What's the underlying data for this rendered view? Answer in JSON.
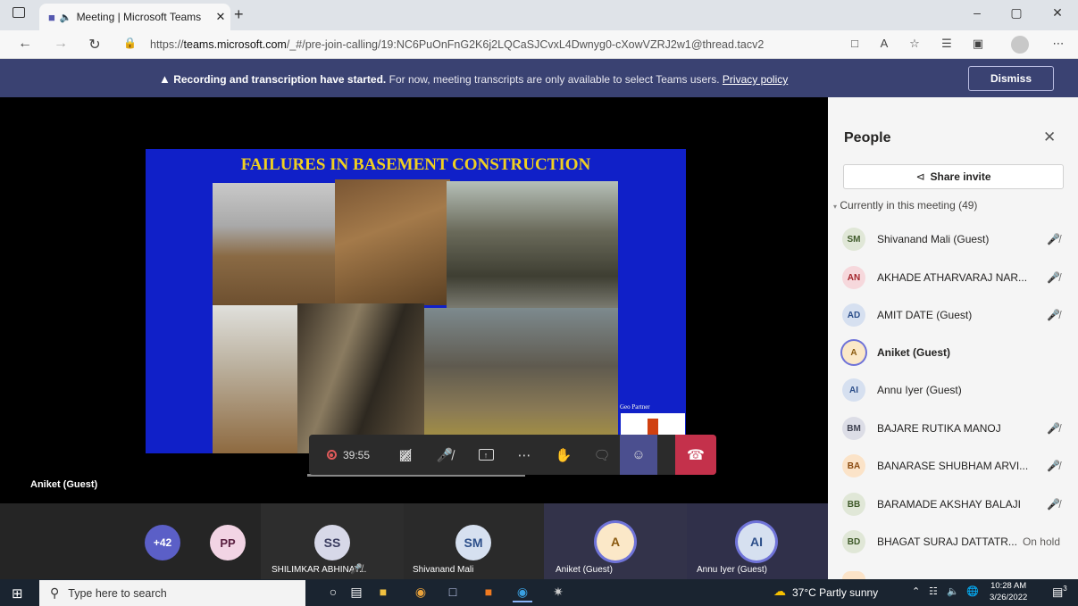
{
  "browser": {
    "tab_title": "Meeting | Microsoft Teams",
    "tab_audio_icon": "speaker-icon",
    "new_tab": "+",
    "url_prefix": "https://",
    "url_host": "teams.microsoft.com",
    "url_path": "/_#/pre-join-calling/19:NC6PuOnFnG2K6j2LQCaSJCvxL4Dwnyg0-cXowVZRJ2w1@thread.tacv2",
    "win_min": "–",
    "win_max": "▢",
    "win_close": "✕"
  },
  "banner": {
    "bold_text": "Recording and transcription have started.",
    "text": " For now, meeting transcripts are only available to select Teams users. ",
    "link": "Privacy policy",
    "dismiss": "Dismiss",
    "bg": "#3a4272"
  },
  "stage": {
    "slide_title": "FAILURES IN BASEMENT CONSTRUCTION",
    "slide_footer": "Geo Partner",
    "participant_name": "Aniket (Guest)"
  },
  "controls": {
    "timer": "39:55",
    "hangup_color": "#c4314b"
  },
  "strip": {
    "overflow": "+42",
    "tiles": [
      {
        "initials": "PP",
        "name": ""
      },
      {
        "initials": "SS",
        "name": "SHILIMKAR ABHINAY..."
      },
      {
        "initials": "SM",
        "name": "Shivanand Mali"
      },
      {
        "initials": "A",
        "name": "Aniket (Guest)"
      },
      {
        "initials": "AI",
        "name": "Annu Iyer (Guest)"
      }
    ]
  },
  "people": {
    "title": "People",
    "share_label": "Share invite",
    "section": "Currently in this meeting (49)",
    "rows": [
      {
        "initials": "SM",
        "name": "Shivanand Mali (Guest)",
        "status": "",
        "muted": true,
        "bold": false,
        "bg": "#e0e7d7",
        "fg": "#3f5a2a"
      },
      {
        "initials": "AN",
        "name": "AKHADE ATHARVARAJ NAR...",
        "status": "",
        "muted": true,
        "bold": false,
        "bg": "#f6d8dc",
        "fg": "#a4262c"
      },
      {
        "initials": "AD",
        "name": "AMIT DATE (Guest)",
        "status": "",
        "muted": true,
        "bold": false,
        "bg": "#d6e0f0",
        "fg": "#2d4f8a"
      },
      {
        "initials": "A",
        "name": "Aniket (Guest)",
        "status": "",
        "muted": false,
        "bold": true,
        "bg": "#fbe8c8",
        "fg": "#8a5a10"
      },
      {
        "initials": "AI",
        "name": "Annu Iyer (Guest)",
        "status": "",
        "muted": false,
        "bold": false,
        "bg": "#d6e0f0",
        "fg": "#2d4f8a"
      },
      {
        "initials": "BM",
        "name": "BAJARE RUTIKA MANOJ",
        "status": "",
        "muted": true,
        "bold": false,
        "bg": "#dcdde6",
        "fg": "#3e4150"
      },
      {
        "initials": "BA",
        "name": "BANARASE SHUBHAM ARVI...",
        "status": "",
        "muted": true,
        "bold": false,
        "bg": "#fbe3c8",
        "fg": "#8a4a10"
      },
      {
        "initials": "BB",
        "name": "BARAMADE AKSHAY BALAJI",
        "status": "",
        "muted": true,
        "bold": false,
        "bg": "#e0e7d7",
        "fg": "#3f5a2a"
      },
      {
        "initials": "BD",
        "name": "BHAGAT SURAJ DATTATR...",
        "status": "On hold",
        "muted": false,
        "bold": false,
        "bg": "#e0e7d7",
        "fg": "#3f5a2a"
      }
    ]
  },
  "taskbar": {
    "search_placeholder": "Type here to search",
    "weather": "37°C  Partly sunny",
    "time": "10:28 AM",
    "date": "3/26/2022",
    "notif_count": "3"
  }
}
